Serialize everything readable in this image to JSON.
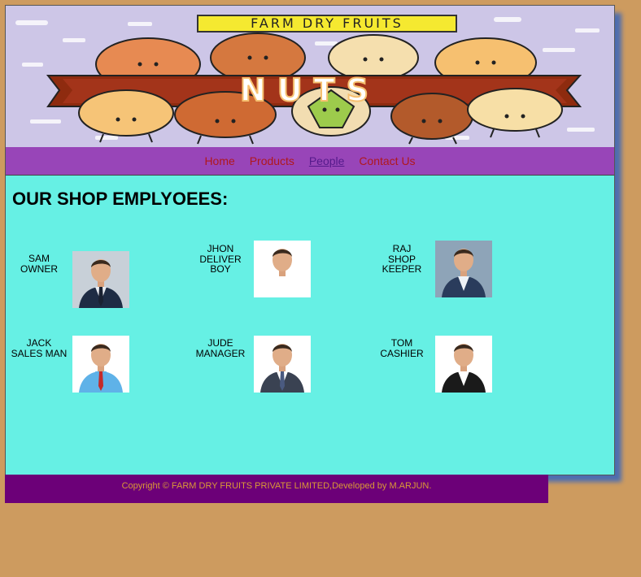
{
  "banner": {
    "title": "FARM DRY FRUITS",
    "big_word": "NUTS"
  },
  "nav": {
    "items": [
      "Home",
      "Products",
      "People",
      "Contact Us"
    ],
    "active": "People"
  },
  "main": {
    "heading": "OUR SHOP EMPLYOEES:",
    "employees": [
      {
        "lines": [
          "SAM",
          "OWNER"
        ],
        "suit": "#1e2c44",
        "shirt": "#e8ecf2",
        "tie": "#1a2232",
        "bg": "#c8d0d8"
      },
      {
        "lines": [
          "JHON",
          "DELIVER",
          "BOY"
        ],
        "suit": "#ffffff",
        "shirt": "#ffffff",
        "tie": "",
        "bg": "#ffffff"
      },
      {
        "lines": [
          "RAJ",
          "SHOP",
          "KEEPER"
        ],
        "suit": "#2a3c5c",
        "shirt": "#eef2f6",
        "tie": "",
        "bg": "#8ea4b8"
      },
      {
        "lines": [
          "JACK",
          "SALES MAN"
        ],
        "suit": "#5fb2e8",
        "shirt": "#5fb2e8",
        "tie": "#c42a2a",
        "bg": "#ffffff"
      },
      {
        "lines": [
          "JUDE",
          "MANAGER"
        ],
        "suit": "#3a4252",
        "shirt": "#ffffff",
        "tie": "#4a5a80",
        "bg": "#ffffff"
      },
      {
        "lines": [
          "TOM",
          "CASHIER"
        ],
        "suit": "#1a1a1a",
        "shirt": "#ffffff",
        "tie": "",
        "bg": "#ffffff"
      }
    ]
  },
  "footer": {
    "text": "Copyright © FARM DRY FRUITS PRIVATE LIMITED,Developed by M.ARJUN."
  }
}
